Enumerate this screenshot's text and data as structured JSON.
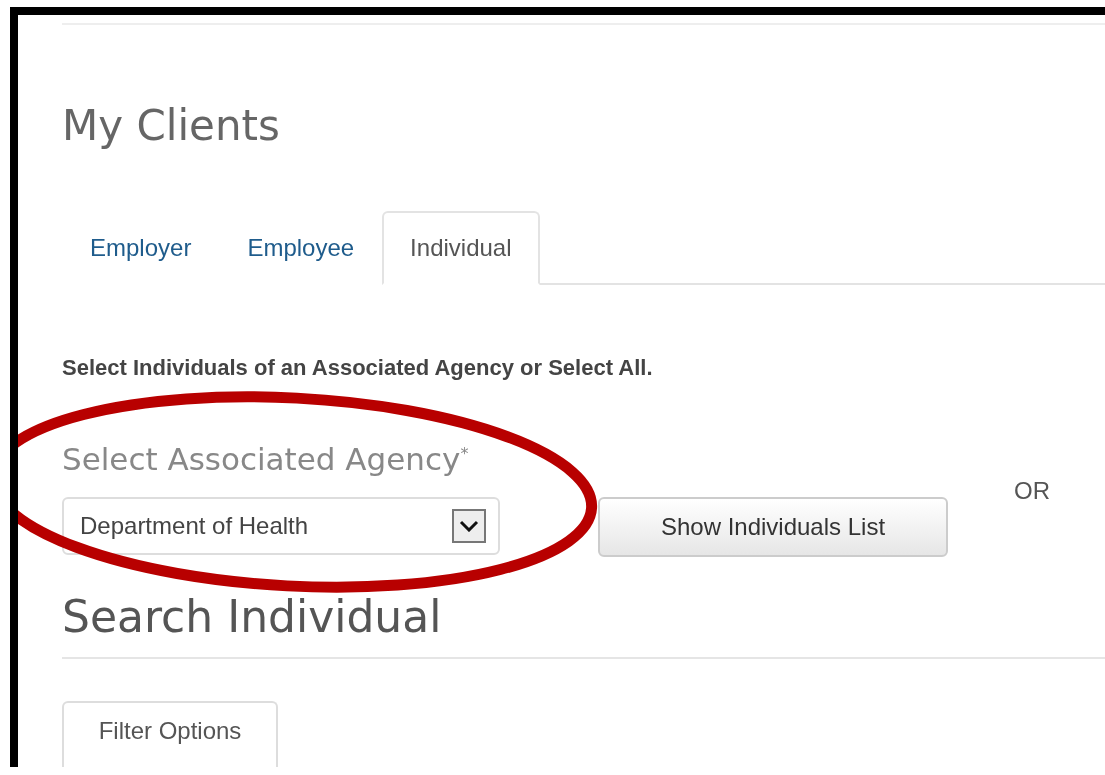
{
  "page_title": "My Clients",
  "tabs": [
    {
      "label": "Employer",
      "selected": false
    },
    {
      "label": "Employee",
      "selected": false
    },
    {
      "label": "Individual",
      "selected": true
    }
  ],
  "instruction": "Select Individuals of an Associated Agency or Select All.",
  "agency_select": {
    "label": "Select Associated Agency$^{*}$",
    "value": "Department of Health"
  },
  "show_button": "Show Individuals List",
  "or_text": "OR",
  "search_heading": "Search Individual",
  "filter_tab": "Filter Options",
  "annotation": {
    "kind": "ellipse",
    "color": "#b80000"
  }
}
